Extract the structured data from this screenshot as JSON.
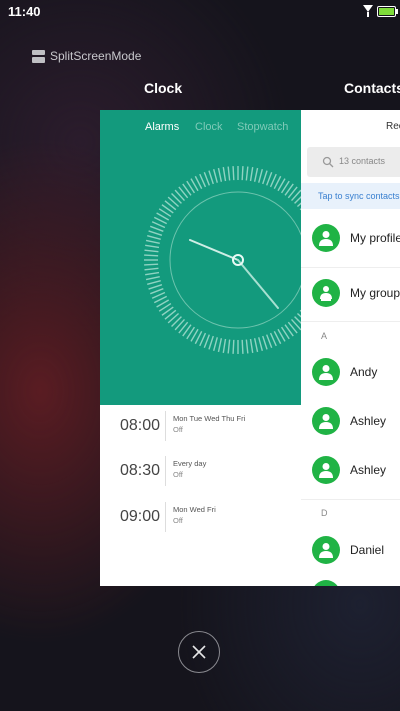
{
  "status": {
    "time": "11:40"
  },
  "split_screen": {
    "label": "SplitScreenMode"
  },
  "cards": {
    "clock_title": "Clock",
    "contacts_title": "Contacts"
  },
  "clock_app": {
    "tabs": [
      "Alarms",
      "Clock",
      "Stopwatch"
    ],
    "alarms": [
      {
        "time": "08:00",
        "days": "Mon Tue Wed Thu Fri",
        "state": "Off"
      },
      {
        "time": "08:30",
        "days": "Every day",
        "state": "Off"
      },
      {
        "time": "09:00",
        "days": "Mon Wed Fri",
        "state": "Off"
      }
    ]
  },
  "contacts_app": {
    "header": "Rec",
    "search_placeholder": "13 contacts",
    "sync_text": "Tap to sync contacts",
    "items": [
      {
        "name": "My profile"
      },
      {
        "name": "My groups"
      }
    ],
    "section_a": "A",
    "contacts_a": [
      {
        "name": "Andy"
      },
      {
        "name": "Ashley"
      },
      {
        "name": "Ashley"
      }
    ],
    "section_d": "D",
    "contacts_d": [
      {
        "name": "Daniel"
      }
    ]
  },
  "colors": {
    "clock_green": "#139a7d",
    "avatar_green": "#20b345",
    "sync_blue": "#3a80d0"
  },
  "icons": {
    "close": "close-icon",
    "search": "search-icon",
    "wifi": "wifi-icon",
    "battery": "battery-icon"
  }
}
